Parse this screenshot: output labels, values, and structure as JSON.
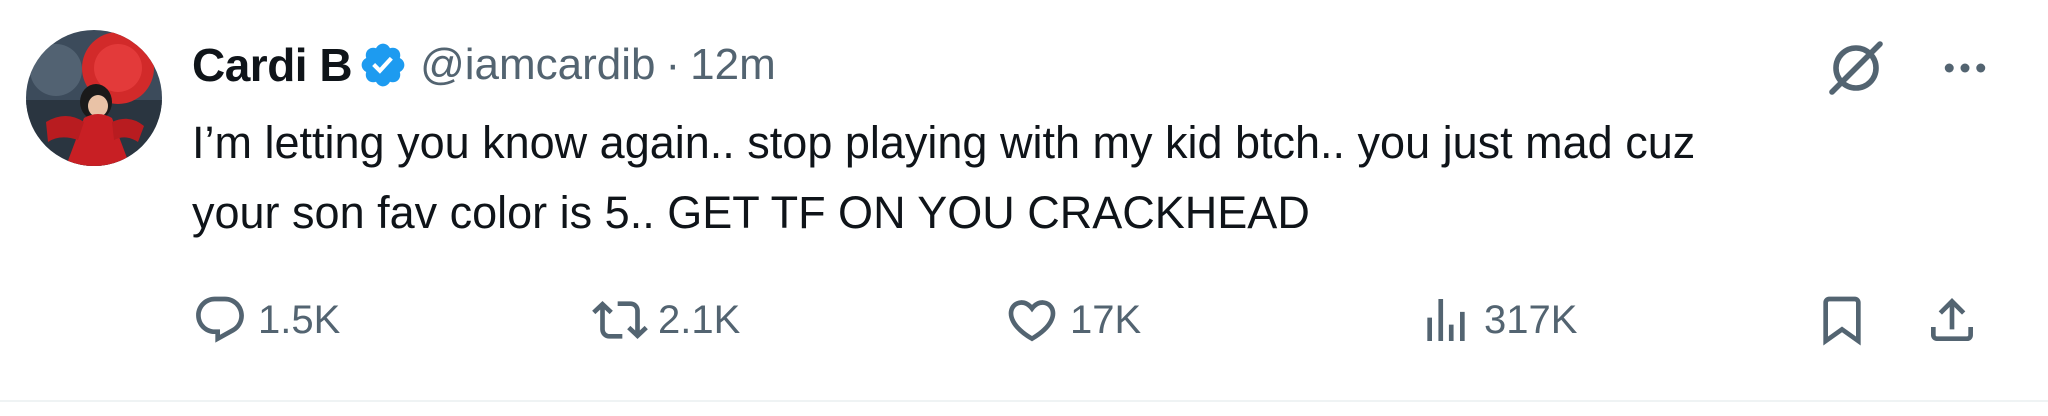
{
  "author": {
    "name": "Cardi B",
    "handle": "@iamcardib",
    "separator": "·",
    "time": "12m",
    "verified": true
  },
  "tweet": {
    "text": "I’m letting you know again.. stop playing with my kid btch.. you just mad cuz\nyour son fav color is 5.. GET TF ON YOU CRACKHEAD"
  },
  "actions": {
    "replies": "1.5K",
    "retweets": "2.1K",
    "likes": "17K",
    "views": "317K"
  },
  "icons": {
    "verified": "verified-badge-icon",
    "grok": "grok-icon",
    "more": "more-icon",
    "reply": "reply-icon",
    "retweet": "retweet-icon",
    "like": "heart-icon",
    "views": "views-icon",
    "bookmark": "bookmark-icon",
    "share": "share-icon"
  },
  "colors": {
    "text": "#0f1419",
    "secondary": "#536471",
    "verified": "#1d9bf0",
    "avatar_red": "#d42a2a",
    "avatar_bg": "#3a4a5a",
    "divider": "#eff3f4"
  }
}
